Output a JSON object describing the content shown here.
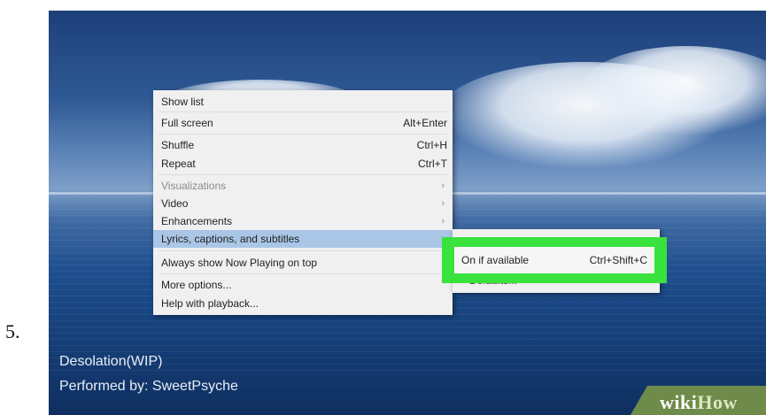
{
  "step_number": "5.",
  "player": {
    "track_title": "Desolation(WIP)",
    "track_artist": "Performed by: SweetPsyche"
  },
  "context_menu": {
    "items": [
      {
        "label": "Show list",
        "shortcut": "",
        "arrow": ""
      },
      {
        "label": "Full screen",
        "shortcut": "Alt+Enter",
        "arrow": ""
      },
      {
        "label": "Shuffle",
        "shortcut": "Ctrl+H",
        "arrow": ""
      },
      {
        "label": "Repeat",
        "shortcut": "Ctrl+T",
        "arrow": ""
      },
      {
        "label": "Visualizations",
        "shortcut": "",
        "arrow": "›",
        "disabled": true
      },
      {
        "label": "Video",
        "shortcut": "",
        "arrow": "›"
      },
      {
        "label": "Enhancements",
        "shortcut": "",
        "arrow": "›"
      },
      {
        "label": "Lyrics, captions, and subtitles",
        "shortcut": "",
        "arrow": "›",
        "highlighted": true
      },
      {
        "label": "Always show Now Playing on top",
        "shortcut": "",
        "arrow": ""
      },
      {
        "label": "More options...",
        "shortcut": "",
        "arrow": ""
      },
      {
        "label": "Help with playback...",
        "shortcut": "",
        "arrow": ""
      }
    ]
  },
  "submenu": {
    "option": {
      "label": "On if available",
      "shortcut": "Ctrl+Shift+C"
    },
    "partially_hidden": "Defaults..."
  },
  "watermark": {
    "wiki": "wiki",
    "how": "How"
  },
  "colors": {
    "highlight": "#a9c6e6",
    "callout_green": "#39e23c",
    "menu_bg": "#f0f0f0"
  }
}
